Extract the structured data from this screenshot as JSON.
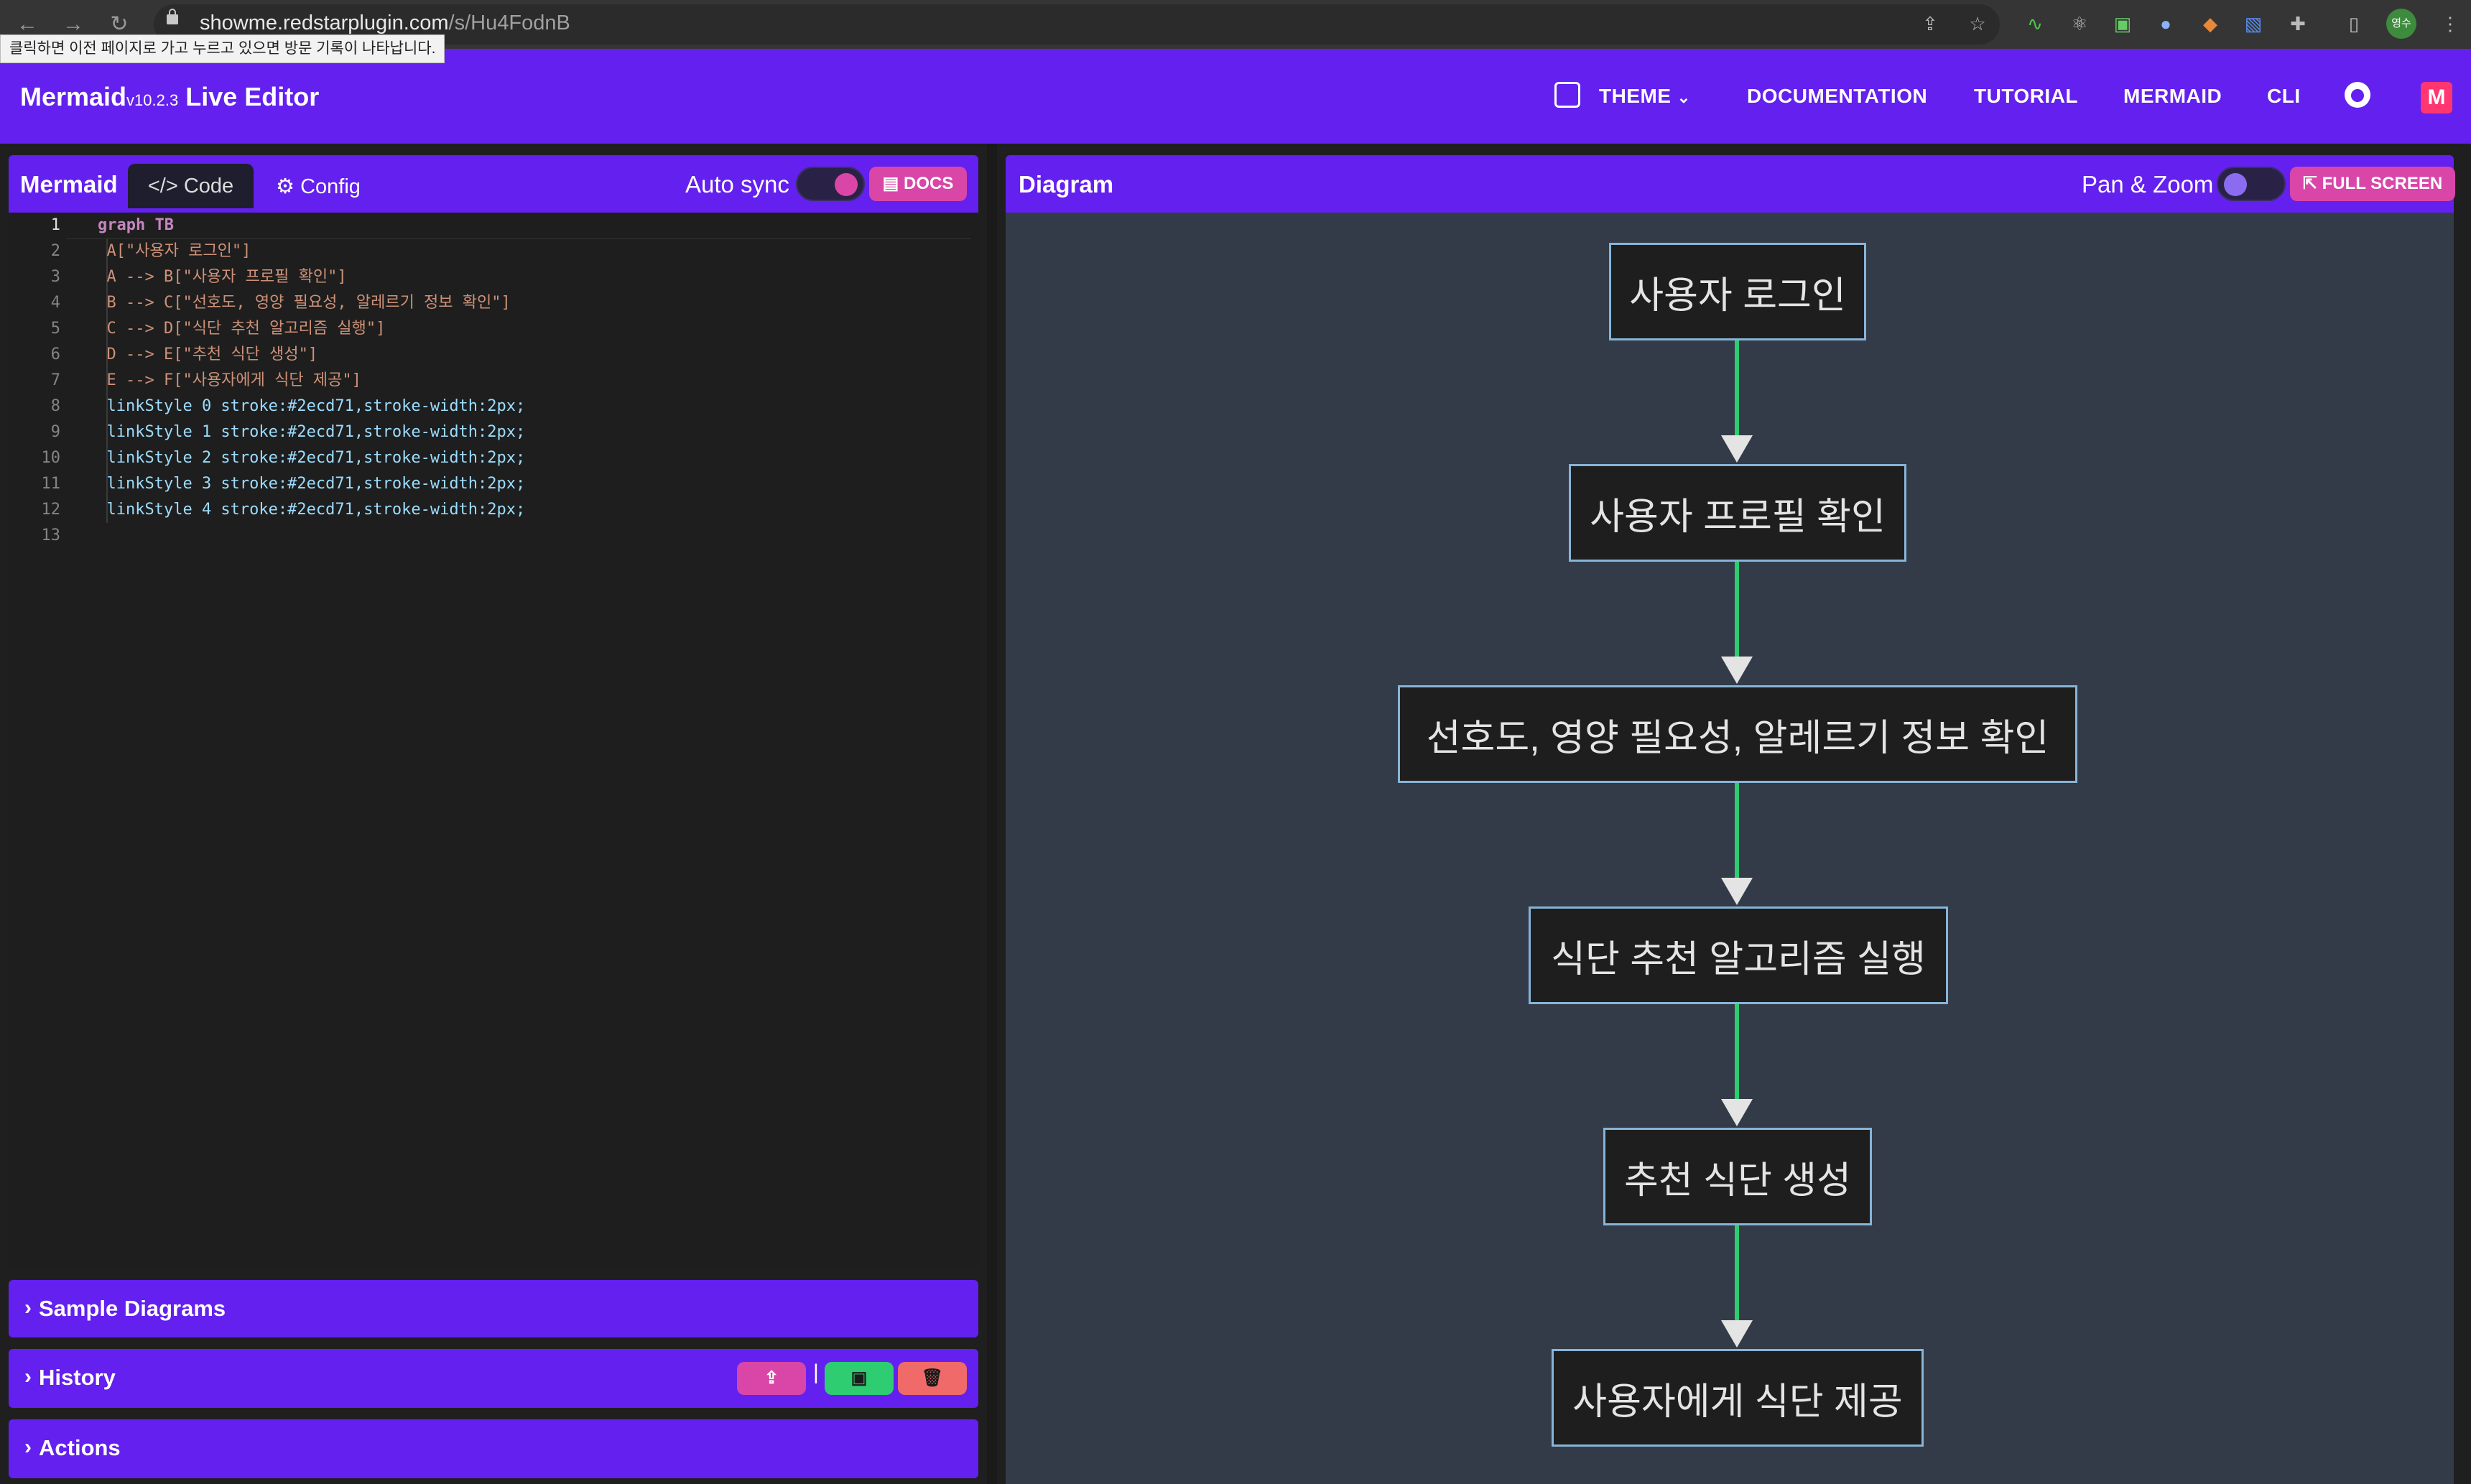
{
  "browser": {
    "url_host": "showme.redstarplugin.com",
    "url_path": "/s/Hu4FodnB",
    "tooltip": "클릭하면 이전 페이지로 가고 누르고 있으면 방문 기록이 나타납니다.",
    "profile": "영수"
  },
  "header": {
    "brand": "Mermaid",
    "version": "v10.2.3",
    "title": "Live Editor",
    "nav": {
      "theme": "THEME",
      "documentation": "DOCUMENTATION",
      "tutorial": "TUTORIAL",
      "mermaid": "MERMAID",
      "cli": "CLI"
    }
  },
  "editor_panel": {
    "title": "Mermaid",
    "tab_code": "Code",
    "tab_config": "Config",
    "auto_sync_label": "Auto sync",
    "docs_button": "DOCS",
    "code_lines": [
      "graph TB",
      "  A[\"사용자 로그인\"]",
      "  A --> B[\"사용자 프로필 확인\"]",
      "  B --> C[\"선호도, 영양 필요성, 알레르기 정보 확인\"]",
      "  C --> D[\"식단 추천 알고리즘 실행\"]",
      "  D --> E[\"추천 식단 생성\"]",
      "  E --> F[\"사용자에게 식단 제공\"]",
      "  linkStyle 0 stroke:#2ecd71,stroke-width:2px;",
      "  linkStyle 1 stroke:#2ecd71,stroke-width:2px;",
      "  linkStyle 2 stroke:#2ecd71,stroke-width:2px;",
      "  linkStyle 3 stroke:#2ecd71,stroke-width:2px;",
      "  linkStyle 4 stroke:#2ecd71,stroke-width:2px;",
      ""
    ],
    "line_numbers": [
      "1",
      "2",
      "3",
      "4",
      "5",
      "6",
      "7",
      "8",
      "9",
      "10",
      "11",
      "12",
      "13"
    ]
  },
  "accordions": {
    "sample_diagrams": "Sample Diagrams",
    "history": "History",
    "actions": "Actions"
  },
  "diagram_panel": {
    "title": "Diagram",
    "pan_zoom_label": "Pan & Zoom",
    "fullscreen_button": "FULL SCREEN",
    "nodes": [
      "사용자 로그인",
      "사용자 프로필 확인",
      "선호도, 영양 필요성, 알레르기 정보 확인",
      "식단 추천 알고리즘 실행",
      "추천 식단 생성",
      "사용자에게 식단 제공"
    ],
    "link_color": "#2ecd71"
  },
  "colors": {
    "accent": "#6320ee",
    "pink": "#d946a8",
    "green": "#2ecd71",
    "danger": "#f06a6a"
  }
}
